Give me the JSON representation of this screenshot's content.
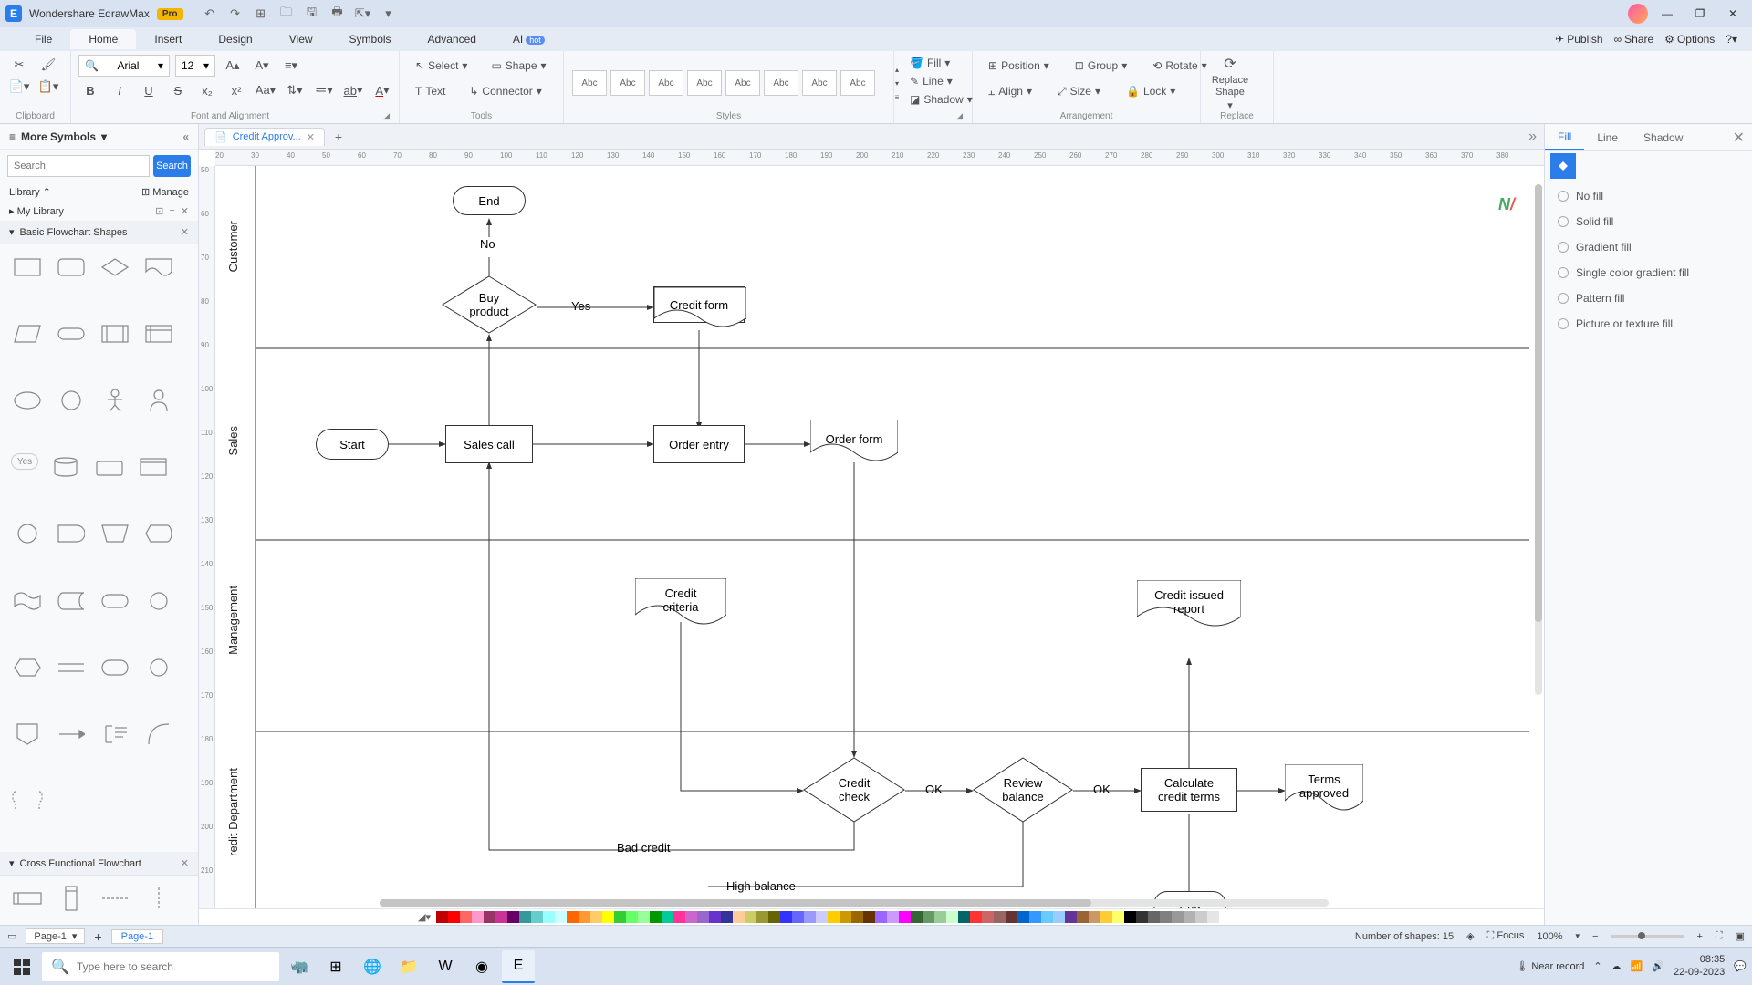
{
  "titlebar": {
    "app_name": "Wondershare EdrawMax",
    "pro": "Pro"
  },
  "window_controls": {
    "min": "—",
    "restore": "❐",
    "close": "✕"
  },
  "menu": {
    "items": [
      "File",
      "Home",
      "Insert",
      "Design",
      "View",
      "Symbols",
      "Advanced"
    ],
    "ai": "AI",
    "hot": "hot",
    "right": {
      "publish": "Publish",
      "share": "Share",
      "options": "Options"
    }
  },
  "ribbon": {
    "clipboard": "Clipboard",
    "font_align": "Font and Alignment",
    "font": "Arial",
    "size": "12",
    "tools": "Tools",
    "select": "Select",
    "shape": "Shape",
    "text": "Text",
    "connector": "Connector",
    "styles": "Styles",
    "abc": "Abc",
    "fill": "Fill",
    "line": "Line",
    "shadow": "Shadow",
    "arrangement": "Arrangement",
    "position": "Position",
    "group": "Group",
    "rotate": "Rotate",
    "align": "Align",
    "size_btn": "Size",
    "lock": "Lock",
    "replace": "Replace",
    "replace_shape": "Replace\nShape"
  },
  "left": {
    "title": "More Symbols",
    "search_placeholder": "Search",
    "search_btn": "Search",
    "library": "Library",
    "manage": "Manage",
    "mylib": "My Library",
    "section1": "Basic Flowchart Shapes",
    "section2": "Cross Functional Flowchart",
    "yes": "Yes"
  },
  "doc": {
    "tab": "Credit Approv..."
  },
  "ruler_h": [
    20,
    30,
    40,
    50,
    60,
    70,
    80,
    90,
    100,
    110,
    120,
    130,
    140,
    150,
    160,
    170,
    180,
    190,
    200,
    210,
    220,
    230,
    240,
    250,
    260,
    270,
    280,
    290,
    300,
    310,
    320,
    330,
    340,
    350,
    360,
    370,
    380
  ],
  "ruler_v": [
    50,
    60,
    70,
    80,
    90,
    100,
    110,
    120,
    130,
    140,
    150,
    160,
    170,
    180,
    190,
    200,
    210
  ],
  "swimlanes": {
    "l1": "Customer",
    "l2": "Sales",
    "l3": "Management",
    "l4": "redit Department"
  },
  "shapes": {
    "end": "End",
    "no": "No",
    "buy": "Buy\nproduct",
    "yes": "Yes",
    "creditform": "Credit form",
    "start": "Start",
    "salescall": "Sales call",
    "orderentry": "Order entry",
    "orderform": "Order form",
    "creditcriteria": "Credit\ncriteria",
    "creditcheck": "Credit\ncheck",
    "ok1": "OK",
    "reviewbalance": "Review\nbalance",
    "ok2": "OK",
    "calcterms": "Calculate\ncredit terms",
    "creditissued": "Credit issued\nreport",
    "termsapproved": "Terms\napproved",
    "badcredit": "Bad credit",
    "highbalance": "High balance",
    "end2": "End"
  },
  "right": {
    "tabs": {
      "fill": "Fill",
      "line": "Line",
      "shadow": "Shadow"
    },
    "opts": [
      "No fill",
      "Solid fill",
      "Gradient fill",
      "Single color gradient fill",
      "Pattern fill",
      "Picture or texture fill"
    ]
  },
  "status": {
    "page": "Page-1",
    "page_tab": "Page-1",
    "shapes": "Number of shapes: 15",
    "focus": "Focus",
    "zoom": "100%"
  },
  "taskbar": {
    "search_ph": "Type here to search",
    "weather": "Near record",
    "time": "08:35",
    "date": "22-09-2023"
  },
  "colors": [
    "#c00000",
    "#ff0000",
    "#ff6666",
    "#ff99cc",
    "#993366",
    "#cc3399",
    "#660066",
    "#339999",
    "#66cccc",
    "#99ffff",
    "#ccffff",
    "#ff6600",
    "#ff9933",
    "#ffcc66",
    "#ffff00",
    "#33cc33",
    "#66ff66",
    "#99ff99",
    "#009900",
    "#00cc99",
    "#ff3399",
    "#cc66cc",
    "#9966cc",
    "#6633cc",
    "#333399",
    "#ffcc99",
    "#cccc66",
    "#999933",
    "#666600",
    "#3333ff",
    "#6666ff",
    "#9999ff",
    "#ccccff",
    "#ffcc00",
    "#cc9900",
    "#996600",
    "#663300",
    "#9966ff",
    "#cc99ff",
    "#ff00ff",
    "#336633",
    "#669966",
    "#99cc99",
    "#ccffcc",
    "#006666",
    "#ff3333",
    "#cc6666",
    "#996666",
    "#663333",
    "#0066cc",
    "#3399ff",
    "#66ccff",
    "#99ccff",
    "#663399",
    "#996633",
    "#cc9966",
    "#ffcc33",
    "#ffff66",
    "#000000",
    "#333333",
    "#666666",
    "#808080",
    "#999999",
    "#b2b2b2",
    "#cccccc",
    "#e5e5e5"
  ]
}
